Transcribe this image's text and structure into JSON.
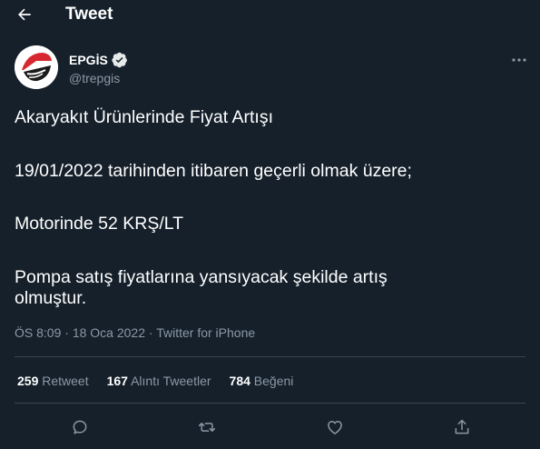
{
  "header": {
    "title": "Tweet",
    "back_icon": "arrow-left-icon"
  },
  "author": {
    "display_name": "EPGİS",
    "handle": "@trepgis",
    "verified_icon": "verified-badge-icon",
    "more_icon": "more-horizontal-icon"
  },
  "tweet": {
    "lines": [
      "Akaryakıt Ürünlerinde Fiyat Artışı",
      "19/01/2022 tarihinden itibaren geçerli olmak üzere;",
      "Motorinde 52 KRŞ/LT",
      "Pompa satış fiyatlarına yansıyacak şekilde artış",
      "olmuştur."
    ]
  },
  "meta": {
    "time": "ÖS 8:09",
    "separator": "·",
    "date": "18 Oca 2022",
    "source": "Twitter for iPhone"
  },
  "stats": {
    "retweets_count": "259",
    "retweets_label": "Retweet",
    "quotes_count": "167",
    "quotes_label": "Alıntı Tweetler",
    "likes_count": "784",
    "likes_label": "Beğeni"
  },
  "actions": [
    "reply-icon",
    "retweet-icon",
    "like-icon",
    "share-icon"
  ],
  "colors": {
    "background": "#15202b",
    "text": "#ffffff",
    "muted": "#8b98a5",
    "divider": "#38444d",
    "logo_red": "#d7282f"
  }
}
